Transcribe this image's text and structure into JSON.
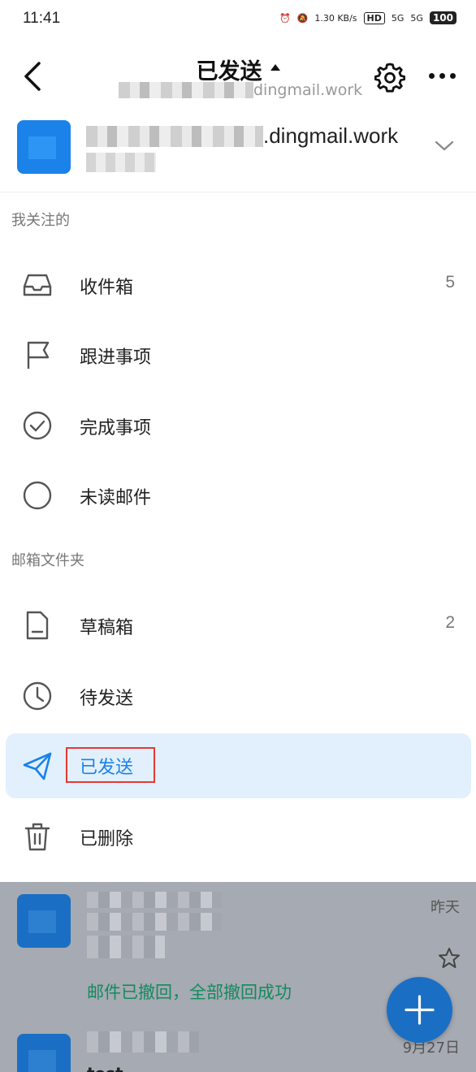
{
  "status_bar": {
    "time": "11:41",
    "net_speed": "1.30 KB/s",
    "hd": "HD",
    "signal1": "5G",
    "signal2": "5G",
    "battery": "100"
  },
  "header": {
    "title": "已发送",
    "subtitle_domain": "dingmail.work"
  },
  "account": {
    "email_domain": ".dingmail.work"
  },
  "sections": {
    "followed": "我关注的",
    "folders": "邮箱文件夹"
  },
  "menu": {
    "inbox": {
      "label": "收件箱",
      "count": "5",
      "icon": "inbox-icon"
    },
    "follow_up": {
      "label": "跟进事项",
      "icon": "flag-icon"
    },
    "done": {
      "label": "完成事项",
      "icon": "check-circle-icon"
    },
    "unread": {
      "label": "未读邮件",
      "icon": "circle-icon"
    },
    "drafts": {
      "label": "草稿箱",
      "count": "2",
      "icon": "document-icon"
    },
    "outbox": {
      "label": "待发送",
      "icon": "clock-icon"
    },
    "sent": {
      "label": "已发送",
      "icon": "paper-plane-icon"
    },
    "deleted": {
      "label": "已删除",
      "icon": "trash-icon"
    }
  },
  "mail_list": [
    {
      "date": "昨天",
      "preview": "邮件已撤回，全部撤回成功"
    },
    {
      "date": "9月27日",
      "subject": "test"
    }
  ],
  "colors": {
    "accent": "#1a82e8",
    "active_bg": "#e2f0fd",
    "highlight": "#e53935",
    "preview_green": "#138a5e"
  }
}
